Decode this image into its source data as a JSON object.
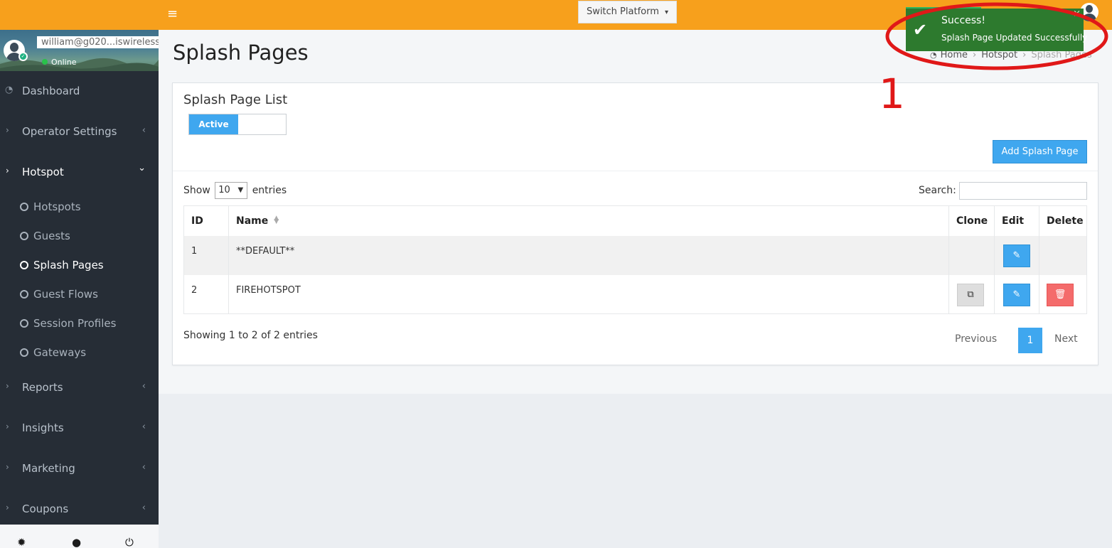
{
  "topbar": {
    "menu_icon": "hamburger-icon",
    "switch_platform_label": "Switch Platform",
    "switch_platform_caret": "▾"
  },
  "user": {
    "email": "william@g020...iswireless",
    "status": "Online"
  },
  "sidebar": {
    "items": [
      {
        "label": "Dashboard",
        "icon": "dashboard-icon"
      },
      {
        "label": "Operator Settings",
        "arrow": "›",
        "chev": "‹"
      },
      {
        "label": "Hotspot",
        "arrow": "›",
        "chev": "⌄"
      },
      {
        "label": "Reports",
        "arrow": "›",
        "chev": "‹"
      },
      {
        "label": "Insights",
        "arrow": "›",
        "chev": "‹"
      },
      {
        "label": "Marketing",
        "arrow": "›",
        "chev": "‹"
      },
      {
        "label": "Coupons",
        "arrow": "›",
        "chev": "‹"
      }
    ],
    "sub_items": [
      {
        "label": "Hotspots"
      },
      {
        "label": "Guests"
      },
      {
        "label": "Splash Pages"
      },
      {
        "label": "Guest Flows"
      },
      {
        "label": "Session Profiles"
      },
      {
        "label": "Gateways"
      }
    ],
    "footer_icons": [
      "gear-icon",
      "user-icon",
      "power-icon"
    ]
  },
  "page": {
    "title": "Splash Pages",
    "breadcrumb": [
      "Home",
      "Hotspot",
      "Splash Pages"
    ]
  },
  "card": {
    "title": "Splash Page List",
    "toggle_active": "Active",
    "add_button": "Add Splash Page",
    "show_label": "Show",
    "entries_label": "entries",
    "length_value": "10",
    "search_label": "Search:",
    "search_value": "",
    "columns": [
      "ID",
      "Name",
      "Clone",
      "Edit",
      "Delete"
    ],
    "rows": [
      {
        "id": "1",
        "name": "**DEFAULT**"
      },
      {
        "id": "2",
        "name": "FIREHOTSPOT"
      }
    ],
    "info": "Showing 1 to 2 of 2 entries",
    "pager": {
      "previous": "Previous",
      "current": "1",
      "next": "Next"
    }
  },
  "toast": {
    "title": "Success!",
    "message": "Splash Page Updated Successfully",
    "close": "×"
  },
  "annotation": {
    "number": "1",
    "color": "#e01818"
  },
  "colors": {
    "topbar": "#f7a01c",
    "sidebar": "#262d36",
    "primary": "#3fa7ef",
    "danger": "#f46b6b",
    "toast": "#2d7a2e"
  }
}
